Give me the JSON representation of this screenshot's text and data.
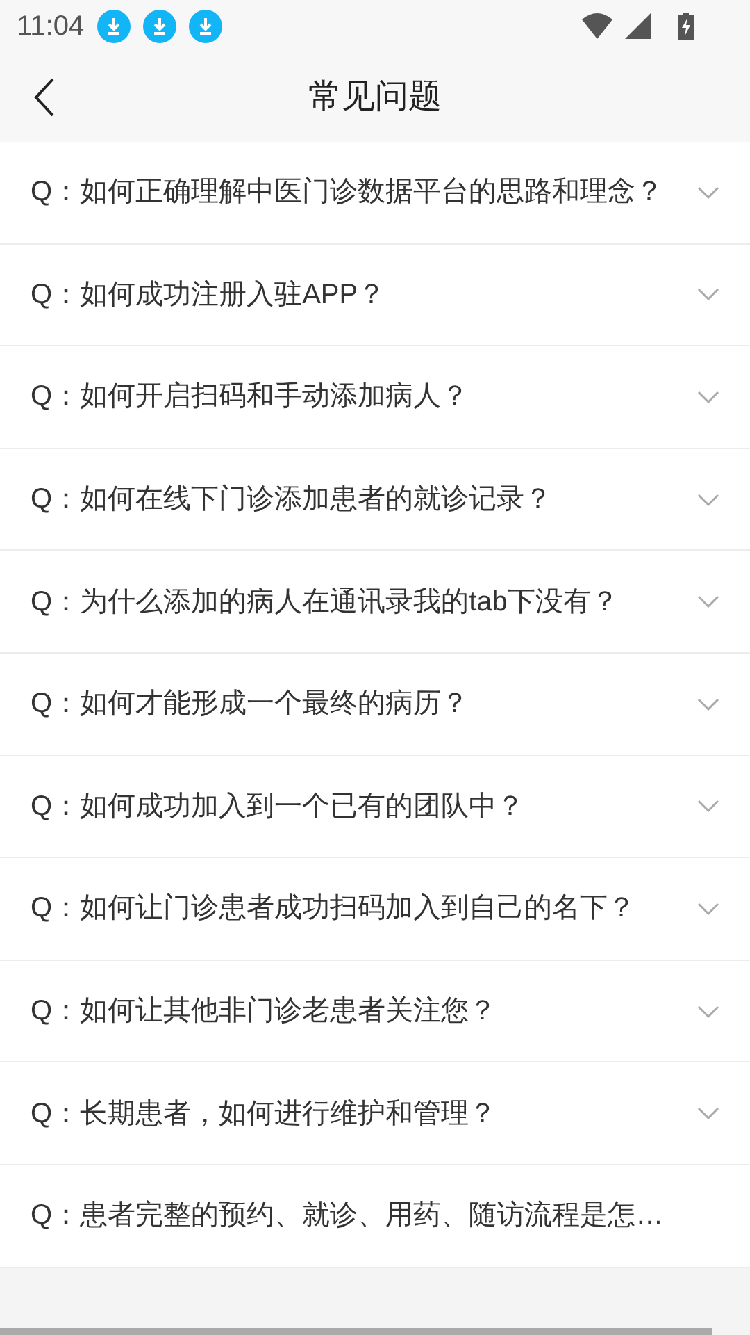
{
  "status_bar": {
    "time": "11:04"
  },
  "header": {
    "title": "常见问题"
  },
  "questions": [
    {
      "prefix": "Q：",
      "text": "如何正确理解中医门诊数据平台的思路和理念？",
      "kind": "collapsible"
    },
    {
      "prefix": "Q：",
      "text": "如何成功注册入驻APP？",
      "kind": "collapsible"
    },
    {
      "prefix": "Q：",
      "text": "如何开启扫码和手动添加病人？",
      "kind": "collapsible"
    },
    {
      "prefix": "Q：",
      "text": "如何在线下门诊添加患者的就诊记录？",
      "kind": "collapsible"
    },
    {
      "prefix": "Q：",
      "text": "为什么添加的病人在通讯录我的tab下没有？",
      "kind": "collapsible"
    },
    {
      "prefix": "Q：",
      "text": "如何才能形成一个最终的病历？",
      "kind": "collapsible"
    },
    {
      "prefix": "Q：",
      "text": "如何成功加入到一个已有的团队中？",
      "kind": "collapsible"
    },
    {
      "prefix": "Q：",
      "text": "如何让门诊患者成功扫码加入到自己的名下？",
      "kind": "collapsible"
    },
    {
      "prefix": "Q：",
      "text": "如何让其他非门诊老患者关注您？",
      "kind": "collapsible"
    },
    {
      "prefix": "Q：",
      "text": "长期患者，如何进行维护和管理？",
      "kind": "collapsible"
    },
    {
      "prefix": "Q：",
      "text": "患者完整的预约、就诊、用药、随访流程是怎…",
      "kind": "plain"
    }
  ]
}
